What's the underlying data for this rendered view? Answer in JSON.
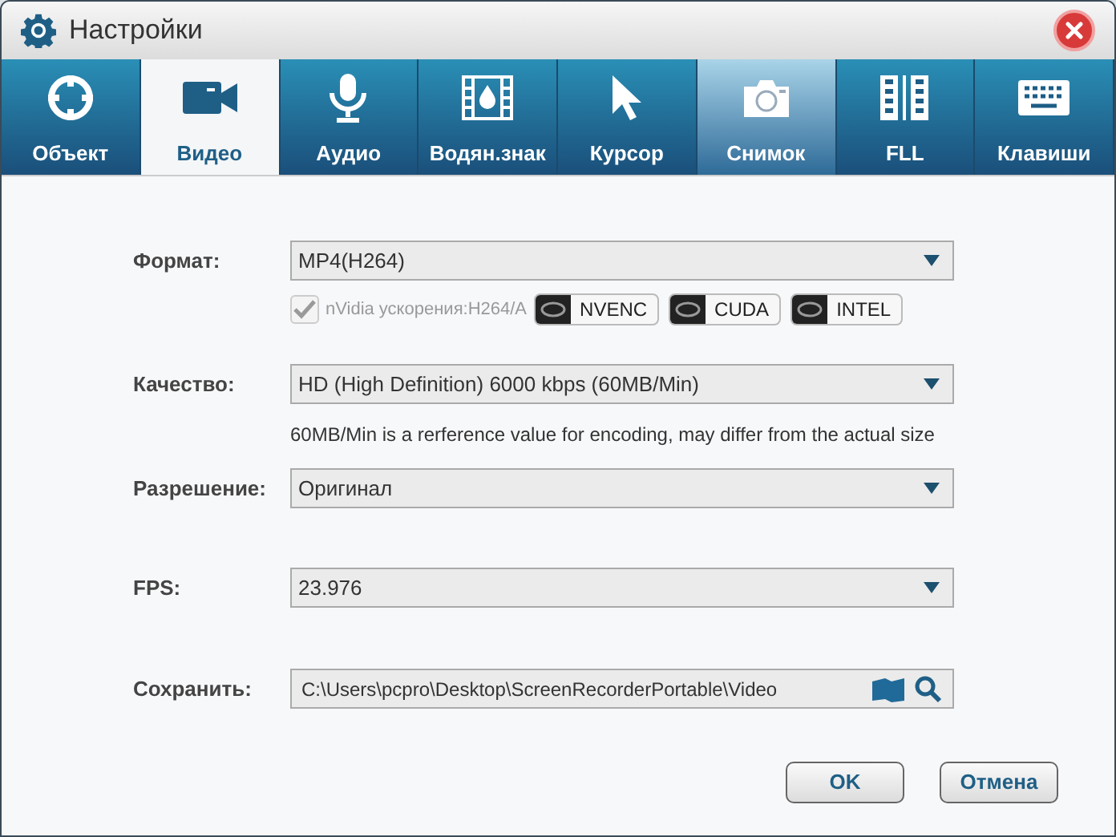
{
  "window": {
    "title": "Настройки"
  },
  "tabs": [
    {
      "label": "Объект",
      "selected": false,
      "hovered": false
    },
    {
      "label": "Видео",
      "selected": true,
      "hovered": false
    },
    {
      "label": "Аудио",
      "selected": false,
      "hovered": false
    },
    {
      "label": "Водян.знак",
      "selected": false,
      "hovered": false
    },
    {
      "label": "Курсор",
      "selected": false,
      "hovered": false
    },
    {
      "label": "Снимок",
      "selected": false,
      "hovered": true
    },
    {
      "label": "FLL",
      "selected": false,
      "hovered": false
    },
    {
      "label": "Клавиши",
      "selected": false,
      "hovered": false
    }
  ],
  "format": {
    "label": "Формат:",
    "value": "MP4(H264)"
  },
  "acceleration": {
    "label": "nVidia ускорения:H264/A",
    "checked": true,
    "disabled": true,
    "badges": [
      "NVENC",
      "CUDA",
      "INTEL"
    ]
  },
  "quality": {
    "label": "Качество:",
    "value": "HD (High Definition) 6000 kbps (60MB/Min)",
    "note": "60MB/Min is a rerference value for encoding, may differ from the actual size"
  },
  "resolution": {
    "label": "Разрешение:",
    "value": "Оригинал"
  },
  "fps": {
    "label": "FPS:",
    "value": "23.976"
  },
  "save": {
    "label": "Сохранить:",
    "value": "C:\\Users\\pcpro\\Desktop\\ScreenRecorderPortable\\Video"
  },
  "buttons": [
    "OK",
    "Отмена"
  ]
}
